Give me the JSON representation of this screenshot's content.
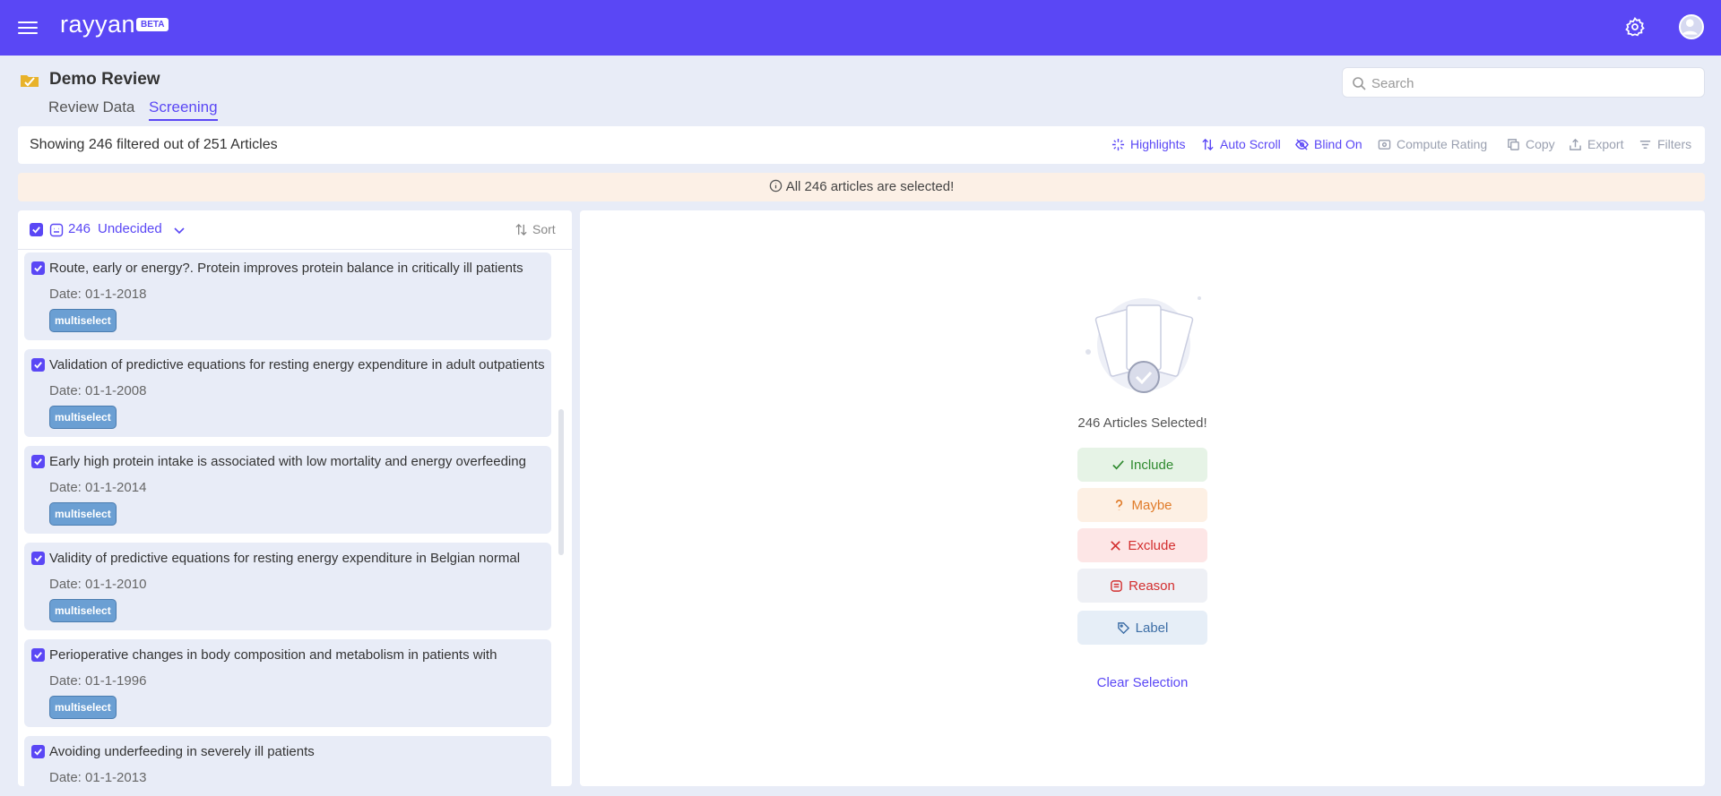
{
  "app": {
    "brand": "rayyan",
    "badge": "BETA"
  },
  "review": {
    "title": "Demo Review",
    "tabs": [
      {
        "label": "Review Data"
      },
      {
        "label": "Screening"
      }
    ],
    "active_tab": "Screening"
  },
  "search": {
    "placeholder": "Search",
    "value": ""
  },
  "toolbar": {
    "showing_text": "Showing 246 filtered out of 251 Articles",
    "highlights": "Highlights",
    "auto_scroll": "Auto Scroll",
    "blind_on": "Blind On",
    "compute_rating": "Compute Rating",
    "copy": "Copy",
    "export": "Export",
    "filters": "Filters"
  },
  "banner": {
    "text": "All 246 articles are selected!"
  },
  "list": {
    "count": "246",
    "status": "Undecided",
    "sort_label": "Sort",
    "items": [
      {
        "title": "Route, early or energy?. Protein improves protein balance in critically ill patients",
        "date": "Date: 01-1-2018",
        "tag": "multiselect"
      },
      {
        "title": "Validation of predictive equations for resting energy expenditure in adult outpatients",
        "date": "Date: 01-1-2008",
        "tag": "multiselect"
      },
      {
        "title": "Early high protein intake is associated with low mortality and energy overfeeding",
        "date": "Date: 01-1-2014",
        "tag": "multiselect"
      },
      {
        "title": "Validity of predictive equations for resting energy expenditure in Belgian normal",
        "date": "Date: 01-1-2010",
        "tag": "multiselect"
      },
      {
        "title": "Perioperative changes in body composition and metabolism in patients with",
        "date": "Date: 01-1-1996",
        "tag": "multiselect"
      },
      {
        "title": "Avoiding underfeeding in severely ill patients",
        "date": "Date: 01-1-2013",
        "tag": "multiselect"
      }
    ]
  },
  "selection": {
    "text": "246 Articles Selected!",
    "include": "Include",
    "maybe": "Maybe",
    "exclude": "Exclude",
    "reason": "Reason",
    "label": "Label",
    "clear": "Clear Selection"
  },
  "colors": {
    "brand": "#5a47f5",
    "tag": "#6b9fd3",
    "include": "#2f8a2f",
    "maybe": "#e07b29",
    "exclude": "#d32f2f"
  }
}
